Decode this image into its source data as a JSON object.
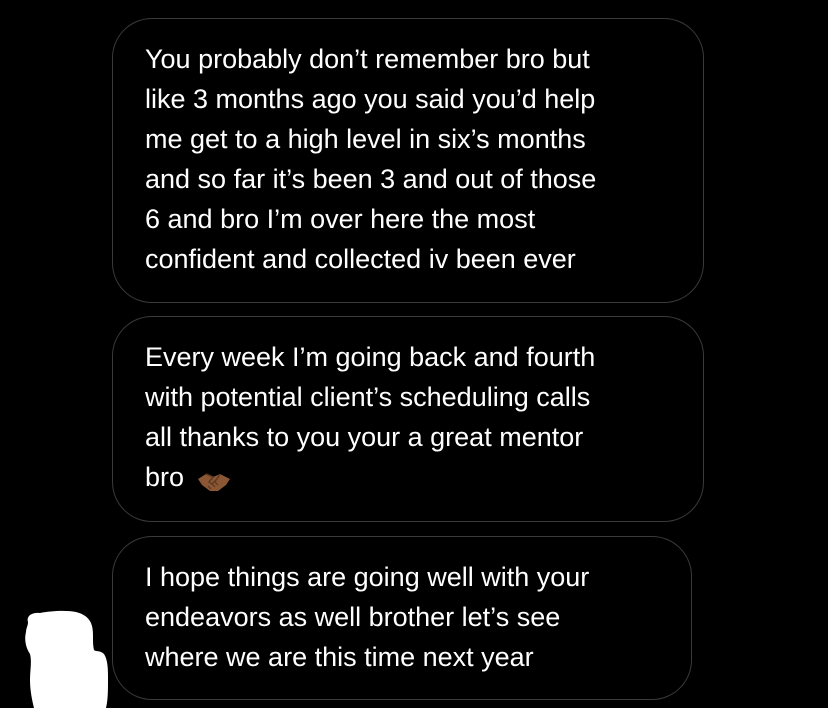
{
  "conversation": {
    "messages": [
      {
        "lines": [
          "You probably don’t remember bro but",
          "like 3 months ago you said you’d help",
          "me get to a high level in six’s months",
          "and so far it’s been 3 and out of those",
          "6 and bro I’m over here the most",
          "confident and collected iv been ever"
        ]
      },
      {
        "lines": [
          "Every week I’m going back and fourth",
          "with potential client’s scheduling calls",
          "all thanks to you your a great mentor",
          "bro"
        ],
        "emoji": "handshake-emoji"
      },
      {
        "lines": [
          "I hope things are going well with your",
          "endeavors as well brother let’s see",
          "where we are this time next year"
        ]
      }
    ]
  },
  "colors": {
    "background": "#000000",
    "bubble_border": "#3a3a3c",
    "text": "#ffffff",
    "emoji_skin": "#8a5634",
    "redaction": "#ffffff"
  }
}
